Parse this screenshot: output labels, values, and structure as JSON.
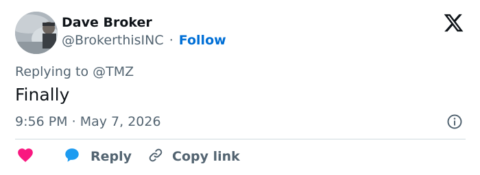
{
  "author": {
    "display_name": "Dave Broker",
    "handle": "@BrokerthisINC",
    "separator": "·",
    "follow_label": "Follow"
  },
  "reply_context": {
    "prefix": "Replying to",
    "mention": "@TMZ"
  },
  "tweet": {
    "text": "Finally"
  },
  "meta": {
    "time": "9:56 PM",
    "separator": "·",
    "date": "May 7, 2026"
  },
  "actions": {
    "reply_label": "Reply",
    "copy_link_label": "Copy link"
  },
  "icons": {
    "brand": "x-logo-icon",
    "info": "info-icon",
    "like": "heart-icon",
    "reply": "speech-bubble-icon",
    "copy": "link-icon"
  },
  "colors": {
    "text_primary": "#0f1419",
    "text_secondary": "#536471",
    "link": "#006fd6",
    "like": "#f91880",
    "reply": "#1d9bf0",
    "divider": "#cfd9de"
  }
}
